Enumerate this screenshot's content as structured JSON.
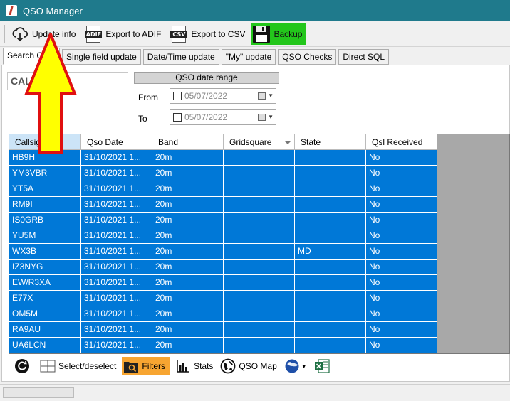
{
  "window": {
    "title": "QSO Manager"
  },
  "toolbar": {
    "update_info": "Update info",
    "export_adif": "Export to ADIF",
    "adif_tag": "ADIF",
    "export_csv": "Export to CSV",
    "csv_tag": "CSV",
    "backup": "Backup",
    "backup_color": "#23c61b"
  },
  "tabs": [
    {
      "label": "Search QSO"
    },
    {
      "label": "Single field update"
    },
    {
      "label": "Date/Time update"
    },
    {
      "label": "\"My\" update"
    },
    {
      "label": "QSO Checks"
    },
    {
      "label": "Direct SQL"
    }
  ],
  "search": {
    "callsign_value": "CAL",
    "date_range_header": "QSO date range",
    "from_label": "From",
    "to_label": "To",
    "from_date": "05/07/2022",
    "to_date": "05/07/2022"
  },
  "grid": {
    "columns": [
      "Callsign",
      "Qso Date",
      "Band",
      "Gridsquare",
      "State",
      "Qsl Received"
    ],
    "rows": [
      [
        "HB9H",
        "31/10/2021 1...",
        "20m",
        "",
        "",
        "No"
      ],
      [
        "YM3VBR",
        "31/10/2021 1...",
        "20m",
        "",
        "",
        "No"
      ],
      [
        "YT5A",
        "31/10/2021 1...",
        "20m",
        "",
        "",
        "No"
      ],
      [
        "RM9I",
        "31/10/2021 1...",
        "20m",
        "",
        "",
        "No"
      ],
      [
        "IS0GRB",
        "31/10/2021 1...",
        "20m",
        "",
        "",
        "No"
      ],
      [
        "YU5M",
        "31/10/2021 1...",
        "20m",
        "",
        "",
        "No"
      ],
      [
        "WX3B",
        "31/10/2021 1...",
        "20m",
        "",
        "MD",
        "No"
      ],
      [
        "IZ3NYG",
        "31/10/2021 1...",
        "20m",
        "",
        "",
        "No"
      ],
      [
        "EW/R3XA",
        "31/10/2021 1...",
        "20m",
        "",
        "",
        "No"
      ],
      [
        "E77X",
        "31/10/2021 1...",
        "20m",
        "",
        "",
        "No"
      ],
      [
        "OM5M",
        "31/10/2021 1...",
        "20m",
        "",
        "",
        "No"
      ],
      [
        "RA9AU",
        "31/10/2021 1...",
        "20m",
        "",
        "",
        "No"
      ],
      [
        "UA6LCN",
        "31/10/2021 1...",
        "20m",
        "",
        "",
        "No"
      ]
    ],
    "selection_color": "#0078d7"
  },
  "bottombar": {
    "select_deselect": "Select/deselect",
    "filters": "Filters",
    "stats": "Stats",
    "qso_map": "QSO Map",
    "filters_color": "#f7a531"
  },
  "annotation": {
    "arrow_fill": "#ffff00",
    "arrow_stroke": "#e01010"
  }
}
